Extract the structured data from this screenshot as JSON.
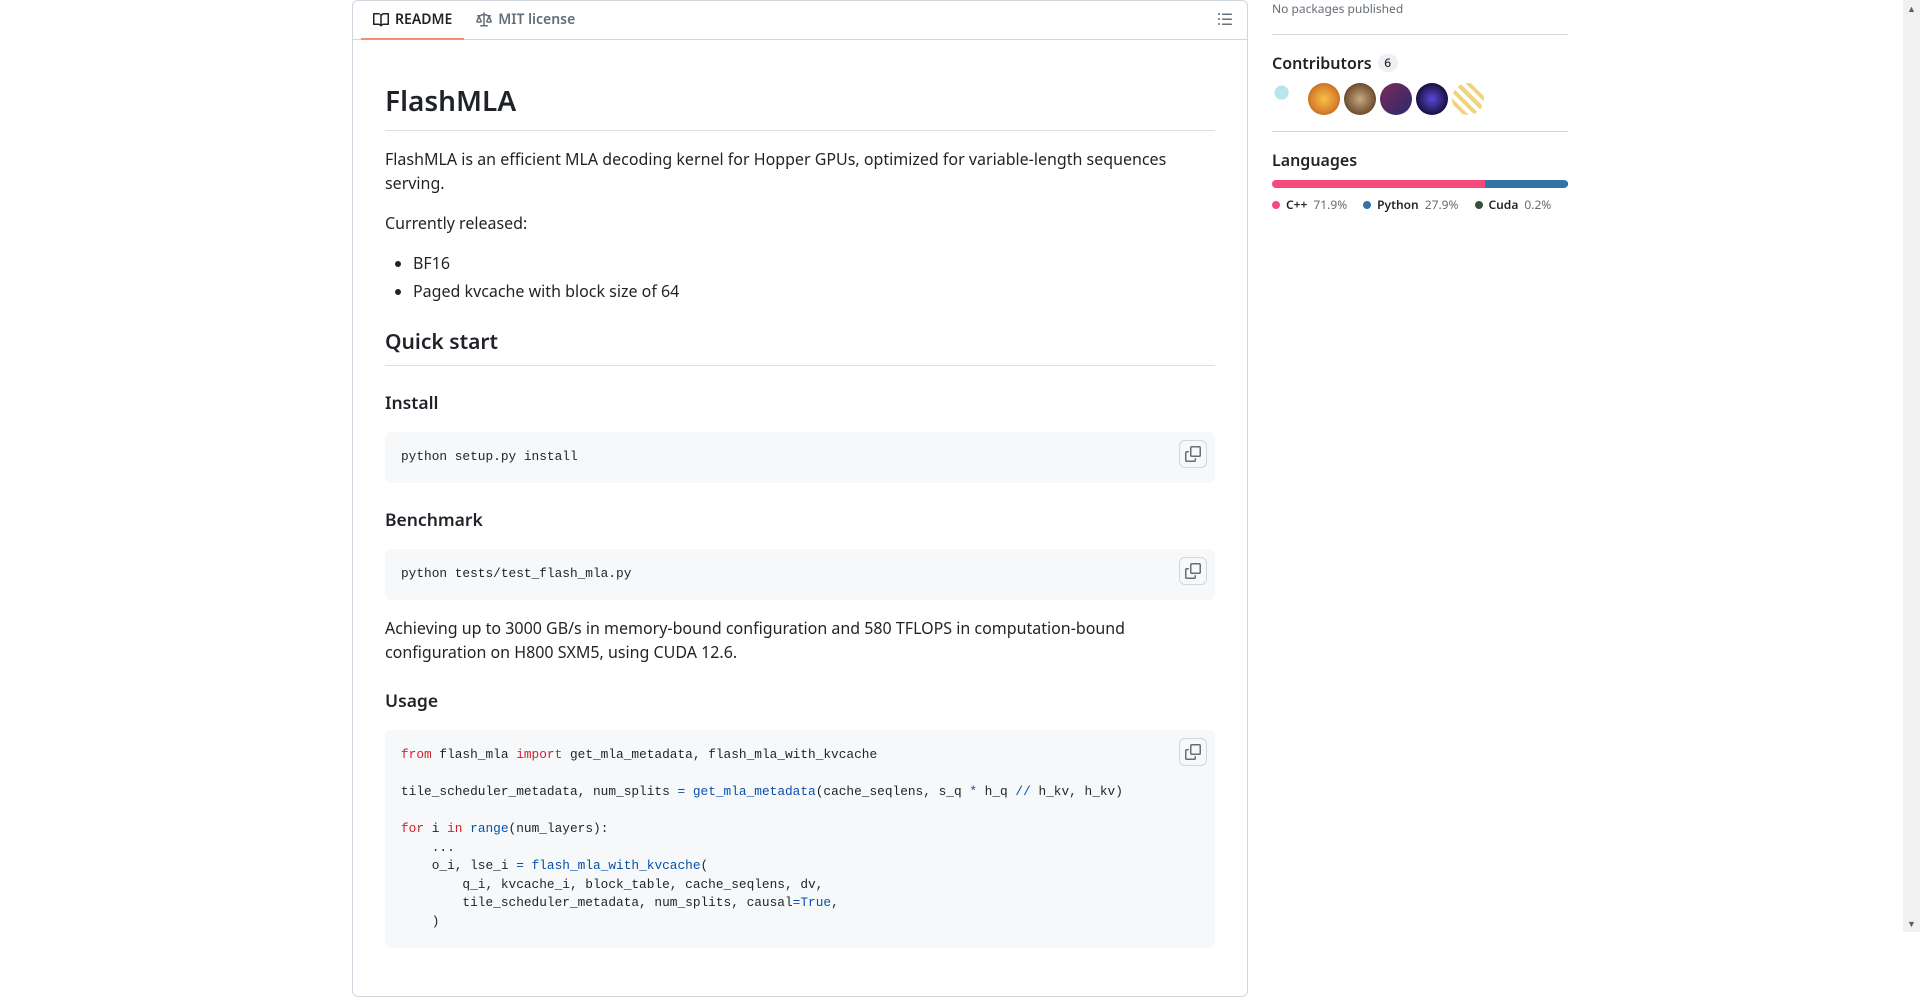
{
  "tabs": {
    "readme": "README",
    "license": "MIT license"
  },
  "readme": {
    "title": "FlashMLA",
    "intro": "FlashMLA is an efficient MLA decoding kernel for Hopper GPUs, optimized for variable-length sequences serving.",
    "currently_released": "Currently released:",
    "features": [
      "BF16",
      "Paged kvcache with block size of 64"
    ],
    "quick_start_heading": "Quick start",
    "install_heading": "Install",
    "install_cmd": "python setup.py install",
    "benchmark_heading": "Benchmark",
    "benchmark_cmd": "python tests/test_flash_mla.py",
    "benchmark_desc": "Achieving up to 3000 GB/s in memory-bound configuration and 580 TFLOPS in computation-bound configuration on H800 SXM5, using CUDA 12.6.",
    "usage_heading": "Usage",
    "usage_code": {
      "l1_from": "from",
      "l1_mod": " flash_mla ",
      "l1_import": "import",
      "l1_names": " get_mla_metadata, flash_mla_with_kvcache",
      "l3_a": "tile_scheduler_metadata, num_splits ",
      "l3_eq": "=",
      "l3_b": " ",
      "l3_fn": "get_mla_metadata",
      "l3_c": "(cache_seqlens, s_q ",
      "l3_mul": "*",
      "l3_d": " h_q ",
      "l3_div": "//",
      "l3_e": " h_kv, h_kv)",
      "l5_for": "for",
      "l5_a": " i ",
      "l5_in": "in",
      "l5_b": " ",
      "l5_range": "range",
      "l5_c": "(num_layers):",
      "l6": "    ...",
      "l7_a": "    o_i, lse_i ",
      "l7_eq": "=",
      "l7_b": " ",
      "l7_fn": "flash_mla_with_kvcache",
      "l7_c": "(",
      "l8": "        q_i, kvcache_i, block_table, cache_seqlens, dv,",
      "l9_a": "        tile_scheduler_metadata, num_splits, causal",
      "l9_eq": "=",
      "l9_true": "True",
      "l9_b": ",",
      "l10": "    )"
    }
  },
  "sidebar": {
    "packages_empty": "No packages published",
    "contributors_heading": "Contributors",
    "contributors_count": "6",
    "avatars": [
      {
        "bg": "radial-gradient(circle at 30% 30%, #b9e6ea 22%, #fff 23%, #fff 100%)"
      },
      {
        "bg": "radial-gradient(circle, #f7c14a 0%, #d8802a 60%, #8a4a19 100%)"
      },
      {
        "bg": "radial-gradient(circle, #c7a880 0%, #7a5a3a 60%, #3a2a1a 100%)"
      },
      {
        "bg": "linear-gradient(135deg, #7a2a5a, #2a2a6a)"
      },
      {
        "bg": "radial-gradient(circle, #5a4ad8 0%, #1a1040 70%)"
      },
      {
        "bg": "repeating-linear-gradient(45deg, #f2d37a, #f2d37a 4px, #fff 4px, #fff 8px)"
      }
    ],
    "languages_heading": "Languages",
    "languages": [
      {
        "name": "C++",
        "pct": "71.9%",
        "color": "#f34b7d",
        "width": "71.9%"
      },
      {
        "name": "Python",
        "pct": "27.9%",
        "color": "#3572A5",
        "width": "27.9%"
      },
      {
        "name": "Cuda",
        "pct": "0.2%",
        "color": "#3A4E3A",
        "width": "0.2%"
      }
    ]
  }
}
